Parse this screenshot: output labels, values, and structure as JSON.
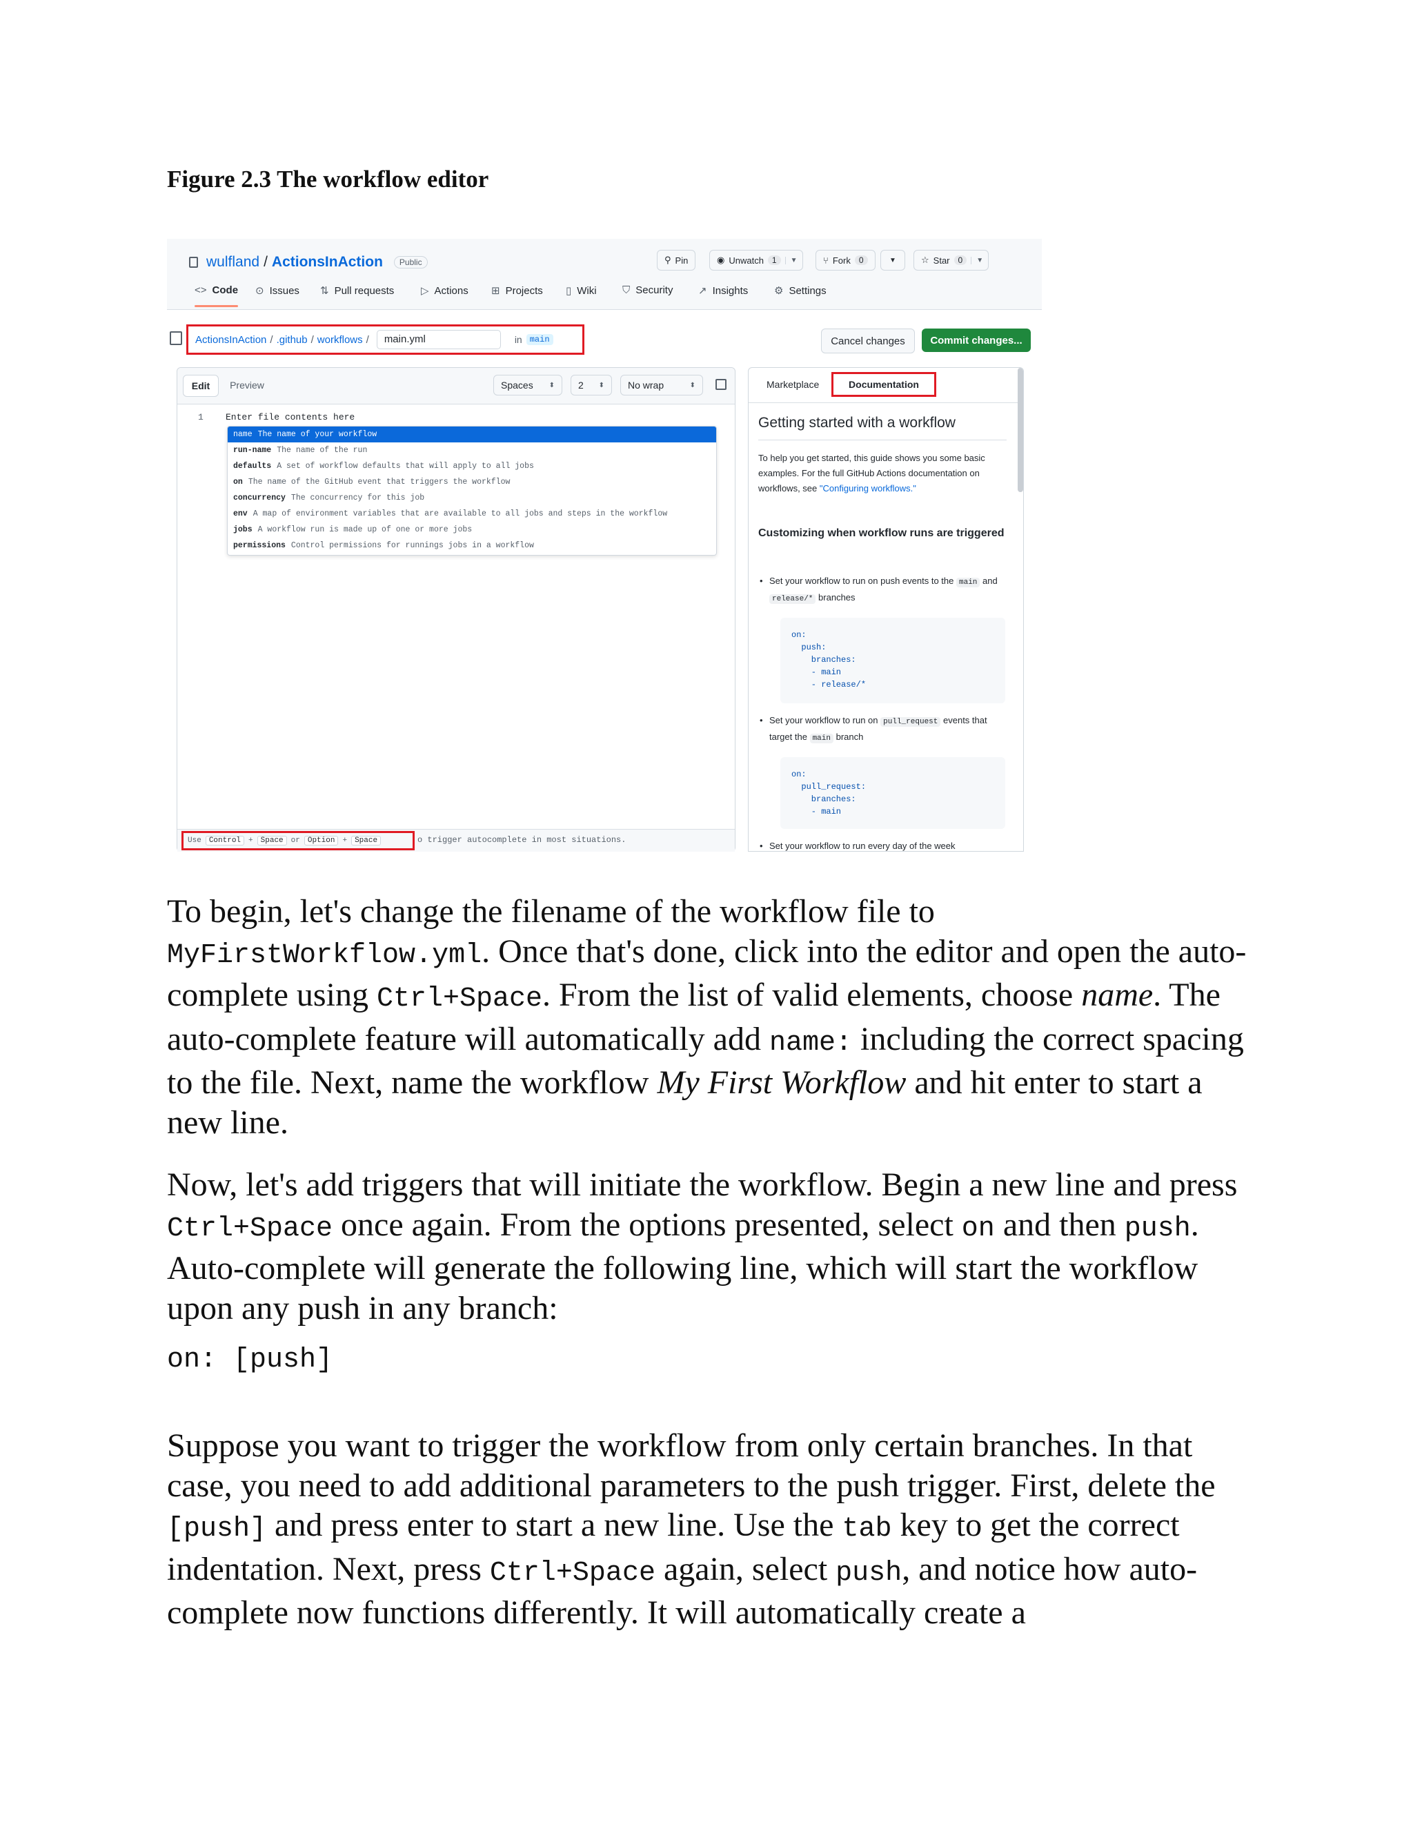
{
  "caption": "Figure 2.3 The workflow editor",
  "screenshot": {
    "repo": {
      "owner": "wulfland",
      "sep": "/",
      "name": "ActionsInAction",
      "visibility": "Public"
    },
    "header_buttons": {
      "pin": "Pin",
      "unwatch": "Unwatch",
      "unwatch_count": "1",
      "fork": "Fork",
      "fork_count": "0",
      "star": "Star",
      "star_count": "0"
    },
    "nav": [
      "Code",
      "Issues",
      "Pull requests",
      "Actions",
      "Projects",
      "Wiki",
      "Security",
      "Insights",
      "Settings"
    ],
    "path": {
      "repo": "ActionsInAction",
      "dir1": ".github",
      "dir2": "workflows",
      "sep": "/",
      "filename": "main.yml",
      "in_label": "in",
      "branch": "main"
    },
    "buttons": {
      "cancel": "Cancel changes",
      "commit": "Commit changes..."
    },
    "editor": {
      "tab_edit": "Edit",
      "tab_preview": "Preview",
      "indent_mode": "Spaces",
      "indent_size": "2",
      "wrap": "No wrap",
      "line_number": "1",
      "placeholder": "Enter file contents here",
      "suggestions": [
        {
          "kw": "name",
          "desc": "The name of your workflow"
        },
        {
          "kw": "run-name",
          "desc": "The name of the run"
        },
        {
          "kw": "defaults",
          "desc": "A set of workflow defaults that will apply to all jobs"
        },
        {
          "kw": "on",
          "desc": "The name of the GitHub event that triggers the workflow"
        },
        {
          "kw": "concurrency",
          "desc": "The concurrency for this job"
        },
        {
          "kw": "env",
          "desc": "A map of environment variables that are available to all jobs and steps in the workflow"
        },
        {
          "kw": "jobs",
          "desc": "A workflow run is made up of one or more jobs"
        },
        {
          "kw": "permissions",
          "desc": "Control permissions for runnings jobs in a workflow"
        }
      ],
      "hint": {
        "use": "Use",
        "ctrl": "Control",
        "plus": "+",
        "space": "Space",
        "or": "or",
        "option": "Option",
        "rest": "o trigger autocomplete in most situations."
      }
    },
    "docs": {
      "tab_marketplace": "Marketplace",
      "tab_docs": "Documentation",
      "title": "Getting started with a workflow",
      "intro": "To help you get started, this guide shows you some basic examples. For the full GitHub Actions documentation on workflows, see ",
      "intro_link": "\"Configuring workflows.\"",
      "subtitle": "Customizing when workflow runs are triggered",
      "b1_a": "Set your workflow to run on push events to the",
      "b1_code1": "main",
      "b1_and": "and",
      "b1_code2": "release/*",
      "b1_end": "branches",
      "code1": "on:\n  push:\n    branches:\n    - main\n    - release/*",
      "b2_a": "Set your workflow to run on",
      "b2_code1": "pull_request",
      "b2_b": "events that target the",
      "b2_code2": "main",
      "b2_end": "branch",
      "code2": "on:\n  pull_request:\n    branches:\n    - main",
      "b3": "Set your workflow to run every day of the week"
    }
  },
  "body": {
    "p1": {
      "t1": "To begin, let's change the filename of the workflow file to ",
      "c1": "MyFirstWorkflow.yml",
      "t2": ". Once that's done, click into the editor and open the auto-complete using ",
      "c2": "Ctrl+Space",
      "t3": ". From the list of valid elements, choose ",
      "i1": "name",
      "t4": ". The auto-complete feature will automatically add ",
      "c3": "name:",
      "t5": " including the correct spacing to the file. Next, name the workflow ",
      "i2": "My First Workflow",
      "t6": " and hit enter to start a new line."
    },
    "p2": {
      "t1": "Now, let's add triggers that will initiate the workflow. Begin a new line and press ",
      "c1": "Ctrl+Space",
      "t2": " once again. From the options presented, select ",
      "c2": "on",
      "t3": " and then ",
      "c3": "push",
      "t4": ". Auto-complete will generate the following line, which will start the workflow upon any push in any branch:"
    },
    "code": "on: [push]",
    "p3": {
      "t1": "Suppose you want to trigger the workflow from only certain branches. In that case, you need to add additional parameters to the push trigger. First, delete the ",
      "c1": "[push]",
      "t2": " and press enter to start a new line. Use the ",
      "c2": "tab",
      "t3": " key to get the correct indentation. Next, press ",
      "c3": "Ctrl+Space",
      "t4": " again, select ",
      "c4": "push",
      "t5": ", and notice how auto-complete now functions differently. It will automatically create a"
    }
  }
}
